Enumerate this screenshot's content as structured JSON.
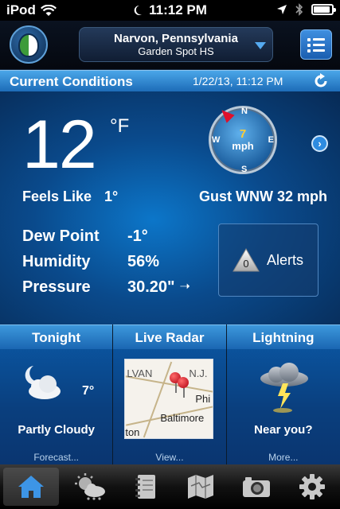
{
  "status_bar": {
    "carrier": "iPod",
    "time": "11:12 PM",
    "battery_level": 0.9
  },
  "header": {
    "location_city": "Narvon, Pennsylvania",
    "location_station": "Garden Spot HS"
  },
  "current_conditions": {
    "title": "Current Conditions",
    "timestamp": "1/22/13, 11:12 PM",
    "temperature": "12",
    "temperature_unit": "°F",
    "feels_like_label": "Feels Like",
    "feels_like_value": "1°",
    "gust_text": "Gust WNW 32 mph",
    "wind": {
      "speed": "7",
      "unit": "mph",
      "n": "N",
      "e": "E",
      "s": "S",
      "w": "W",
      "direction": "NW"
    },
    "dew_point_label": "Dew Point",
    "dew_point_value": "-1°",
    "humidity_label": "Humidity",
    "humidity_value": "56%",
    "pressure_label": "Pressure",
    "pressure_value": "30.20\"",
    "pressure_trend": "➝",
    "alerts_count": "0",
    "alerts_label": "Alerts"
  },
  "panels": {
    "tonight": {
      "title": "Tonight",
      "temp": "7°",
      "condition": "Partly Cloudy",
      "link": "Forecast..."
    },
    "radar": {
      "title": "Live Radar",
      "map_label_1": "LVAN",
      "map_label_2": "N.J.",
      "map_city_1": "Phi",
      "map_city_2": "Baltimore",
      "map_city_3": "ton",
      "link": "View..."
    },
    "lightning": {
      "title": "Lightning",
      "question": "Near you?",
      "link": "More..."
    }
  },
  "tabs": [
    {
      "name": "home",
      "icon": "home-icon",
      "active": true
    },
    {
      "name": "forecast",
      "icon": "weather-icon",
      "active": false
    },
    {
      "name": "notes",
      "icon": "notebook-icon",
      "active": false
    },
    {
      "name": "maps",
      "icon": "map-icon",
      "active": false
    },
    {
      "name": "camera",
      "icon": "camera-icon",
      "active": false
    },
    {
      "name": "settings",
      "icon": "gear-icon",
      "active": false
    }
  ],
  "colors": {
    "accent_blue": "#1d6cb8",
    "panel_blue": "#0a4a8c",
    "wind_speed": "#ffcc33",
    "wind_pointer": "#e0102a"
  }
}
